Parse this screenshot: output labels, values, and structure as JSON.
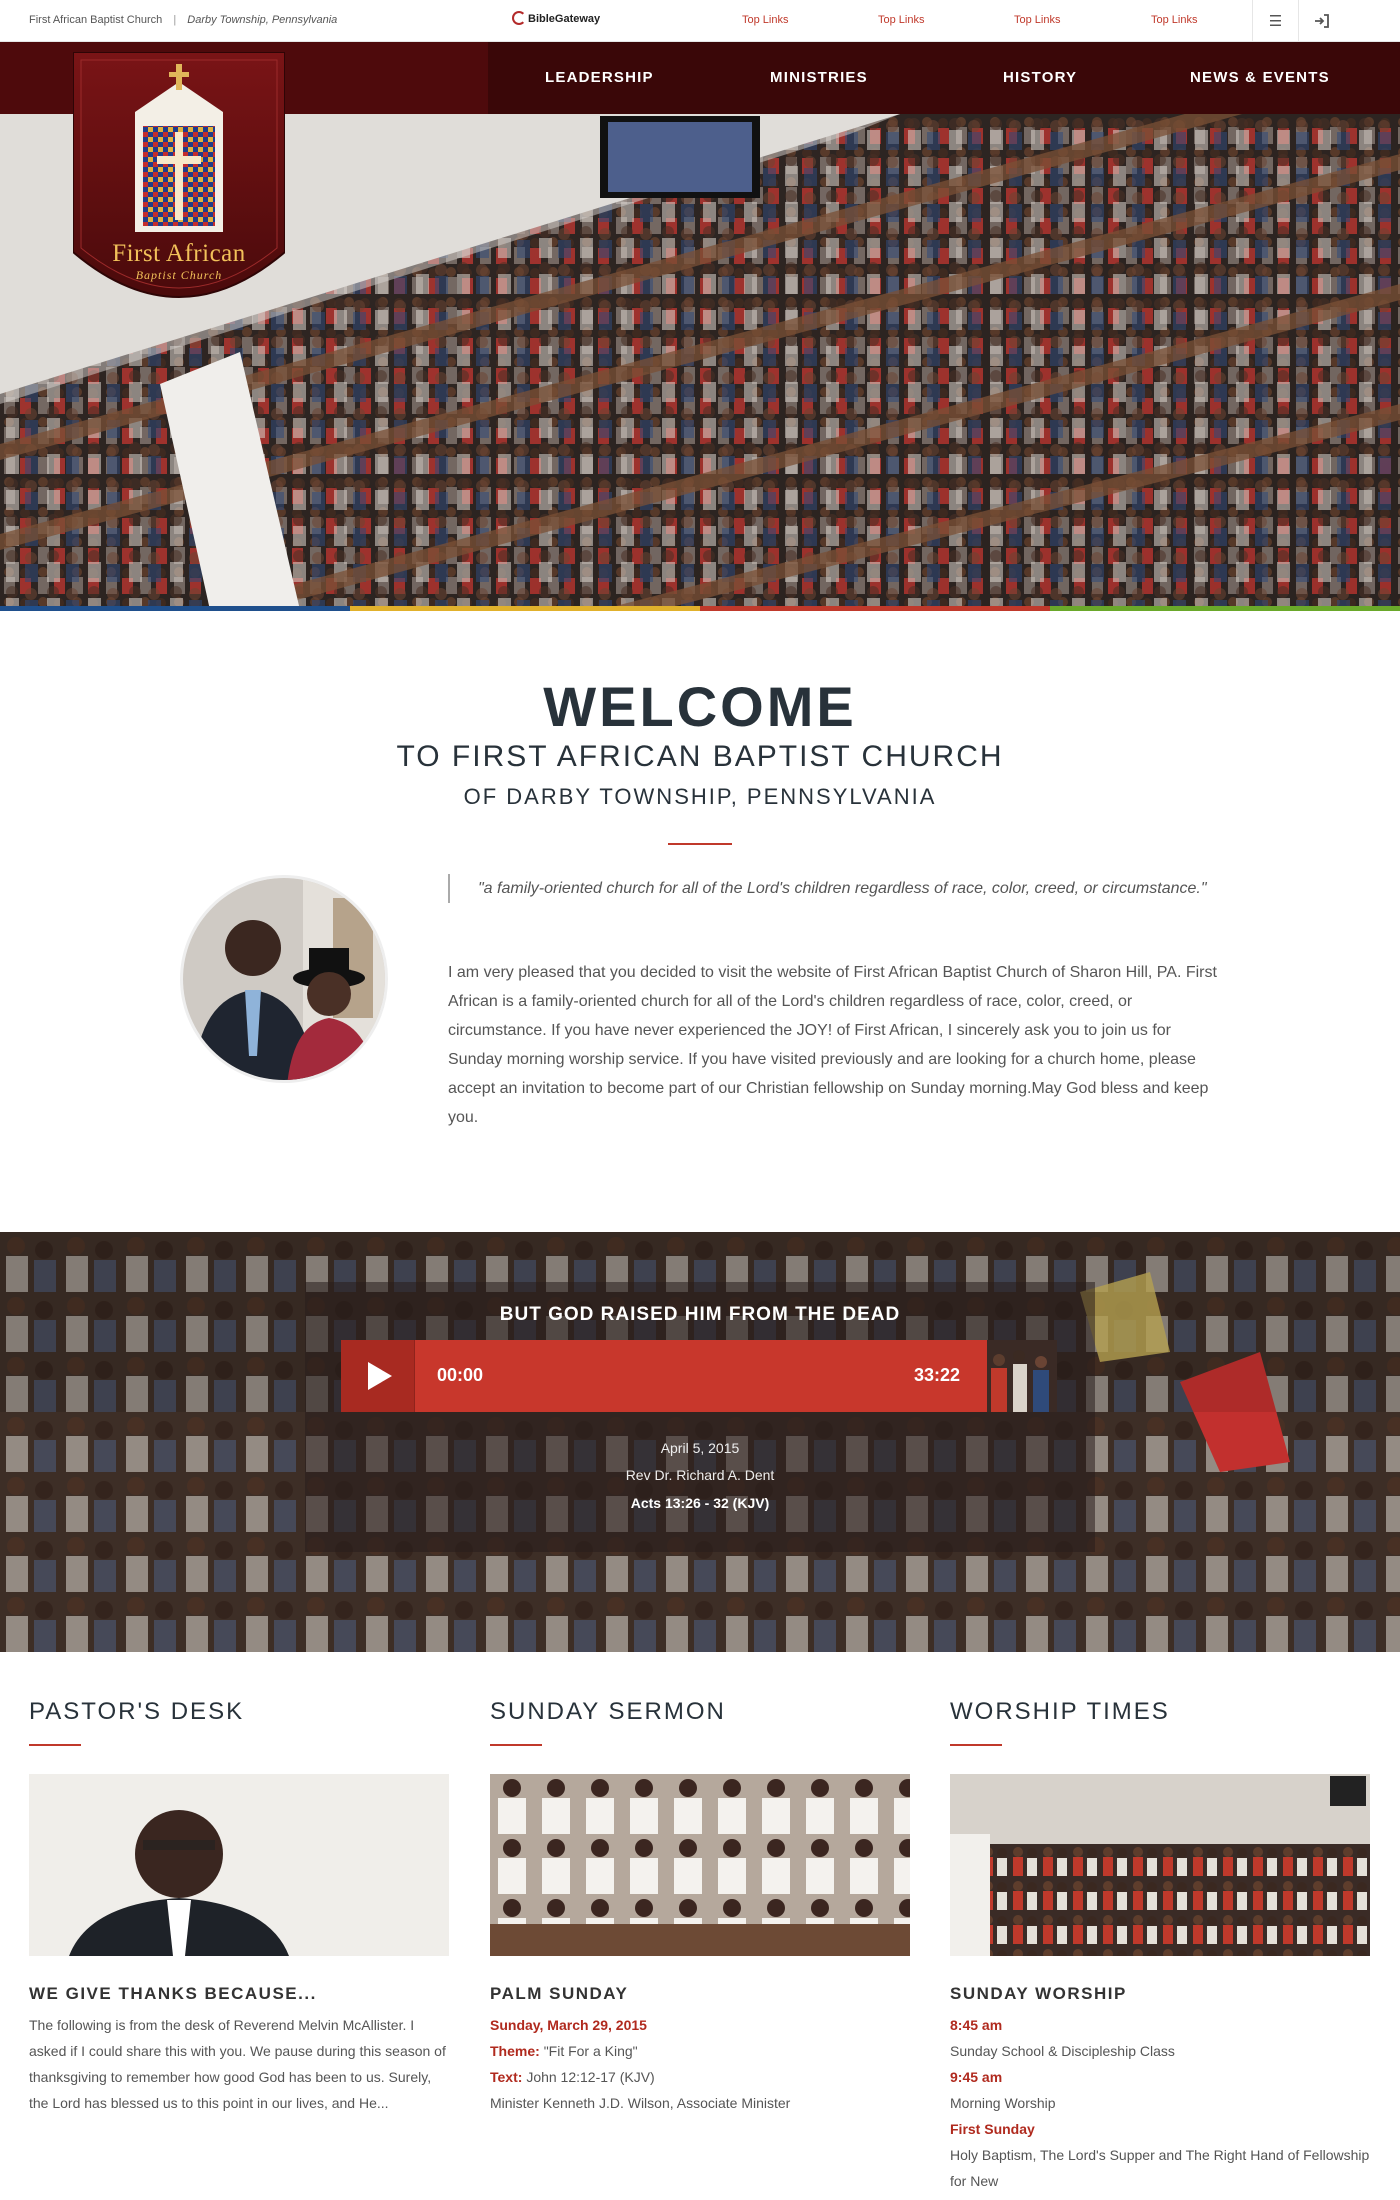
{
  "topbar": {
    "church_name": "First African Baptist Church",
    "separator": "|",
    "location": "Darby Township, Pennsylvania",
    "biblegateway": "BibleGateway",
    "links": [
      "Top Links",
      "Top Links",
      "Top Links",
      "Top Links"
    ],
    "menu_icon": "hamburger-icon",
    "login_icon": "sign-in-icon"
  },
  "logo": {
    "line1": "First African",
    "line2": "Baptist Church"
  },
  "nav": {
    "items": [
      "LEADERSHIP",
      "MINISTRIES",
      "HISTORY",
      "NEWS & EVENTS"
    ]
  },
  "hero": {
    "color_bar": [
      "#1f4f8c",
      "#e1b12c",
      "#c0392b",
      "#6aa82a"
    ]
  },
  "welcome": {
    "title": "WELCOME",
    "subtitle1": "TO FIRST AFRICAN BAPTIST CHURCH",
    "subtitle2": "OF DARBY TOWNSHIP, PENNSYLVANIA",
    "quote": "\"a family-oriented church for all of the Lord's children regardless of race, color, creed, or circumstance.\"",
    "body": "I am very pleased that you decided to visit the website of First African Baptist Church of Sharon Hill, PA. First African is a family-oriented church for all of the Lord's children regardless of race, color, creed, or circumstance. If you have never experienced the JOY! of First African, I sincerely ask you to join us for Sunday morning worship service. If you have visited previously and are looking for a church home, please accept an invitation to become part of our Christian fellowship on Sunday morning.May God bless and keep you."
  },
  "sermon": {
    "title": "BUT GOD RAISED HIM FROM THE DEAD",
    "current_time": "00:00",
    "duration": "33:22",
    "date": "April 5, 2015",
    "preacher": "Rev Dr. Richard A. Dent",
    "scripture": "Acts 13:26 - 32 (KJV)"
  },
  "columns": {
    "pastor": {
      "heading": "PASTOR'S DESK",
      "subheading": "WE GIVE THANKS BECAUSE...",
      "body": "The following is from the desk of Reverend Melvin McAllister. I asked if I could share this with you. We pause during this season of thanksgiving to remember how good God has been to us. Surely, the Lord has blessed us to this point in our lives, and He..."
    },
    "sermon": {
      "heading": "SUNDAY SERMON",
      "subheading": "PALM SUNDAY",
      "date": "Sunday, March 29, 2015",
      "theme_label": "Theme:",
      "theme": "\"Fit For a King\"",
      "text_label": "Text:",
      "text": "John 12:12-17 (KJV)",
      "minister": "Minister Kenneth J.D. Wilson, Associate Minister"
    },
    "worship": {
      "heading": "WORSHIP TIMES",
      "subheading": "SUNDAY WORSHIP",
      "time1": "8:45 am",
      "event1": "Sunday School & Discipleship Class",
      "time2": "9:45 am",
      "event2": "Morning Worship",
      "time3": "First Sunday",
      "event3": "Holy Baptism, The Lord's Supper and The Right Hand of Fellowship for New"
    }
  }
}
